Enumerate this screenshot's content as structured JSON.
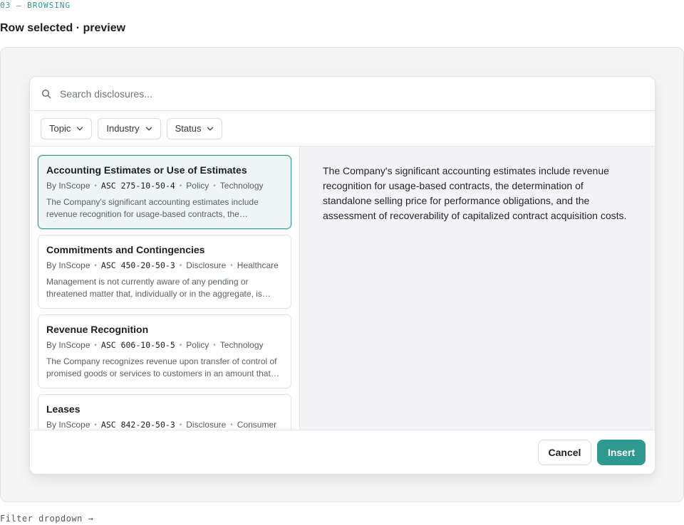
{
  "eyebrow": "03 — BROWSING",
  "page_title": "Row selected · preview",
  "search": {
    "placeholder": "Search disclosures..."
  },
  "filters": [
    {
      "label": "Topic",
      "icon": "chevron-down-icon"
    },
    {
      "label": "Industry",
      "icon": "chevron-down-icon"
    },
    {
      "label": "Status",
      "icon": "chevron-down-icon"
    }
  ],
  "results": [
    {
      "title": "Accounting Estimates or Use of Estimates",
      "author": "By InScope",
      "code": "ASC 275-10-50-4",
      "type": "Policy",
      "industry": "Technology",
      "excerpt": "The Company's significant accounting estimates include revenue recognition for usage-based contracts, the determination of standalone selling price",
      "selected": true
    },
    {
      "title": "Commitments and Contingencies",
      "author": "By InScope",
      "code": "ASC 450-20-50-3",
      "type": "Disclosure",
      "industry": "Healthcare",
      "excerpt": "Management is not currently aware of any pending or threatened matter that, individually or in the aggregate, is expected",
      "selected": false
    },
    {
      "title": "Revenue Recognition",
      "author": "By InScope",
      "code": "ASC 606-10-50-5",
      "type": "Policy",
      "industry": "Technology",
      "excerpt": "The Company recognizes revenue upon transfer of control of promised goods or services to customers in an amount that reflects",
      "selected": false
    },
    {
      "title": "Leases",
      "author": "By InScope",
      "code": "ASC 842-20-50-3",
      "type": "Disclosure",
      "industry": "Consumer",
      "excerpt": "",
      "selected": false
    }
  ],
  "preview": {
    "text": "The Company's significant accounting estimates include revenue recognition for usage-based contracts, the determination of standalone selling price for performance obligations, and the assessment of recoverability of capitalized contract acquisition costs."
  },
  "footer": {
    "cancel_label": "Cancel",
    "insert_label": "Insert"
  },
  "next_link": "Filter dropdown  →",
  "colors": {
    "accent": "#2e9a8f",
    "selected_bg": "#eef5f5",
    "preview_bg": "#f4f3f6"
  }
}
